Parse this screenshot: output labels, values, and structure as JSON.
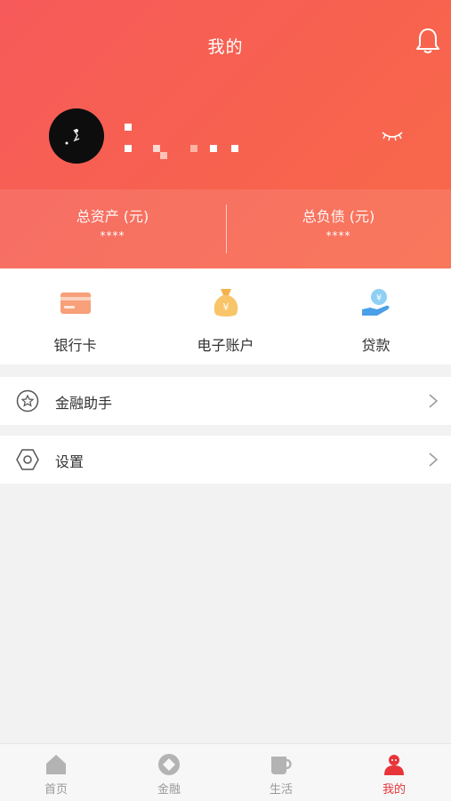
{
  "header": {
    "title": "我的",
    "assets": [
      {
        "label": "总资产 (元)",
        "value": "****"
      },
      {
        "label": "总负债 (元)",
        "value": "****"
      }
    ]
  },
  "quick_actions": [
    {
      "label": "银行卡",
      "icon": "bank-card-icon"
    },
    {
      "label": "电子账户",
      "icon": "money-bag-icon"
    },
    {
      "label": "贷款",
      "icon": "loan-hand-icon"
    }
  ],
  "menu": [
    {
      "label": "金融助手",
      "icon": "star-circle-icon"
    },
    {
      "label": "设置",
      "icon": "hexagon-settings-icon"
    }
  ],
  "tabbar": [
    {
      "label": "首页",
      "icon": "home-icon"
    },
    {
      "label": "金融",
      "icon": "finance-icon"
    },
    {
      "label": "生活",
      "icon": "cup-icon"
    },
    {
      "label": "我的",
      "icon": "person-icon",
      "active": true
    }
  ],
  "colors": {
    "accent": "#e8353a",
    "header": "#f75a5a"
  }
}
